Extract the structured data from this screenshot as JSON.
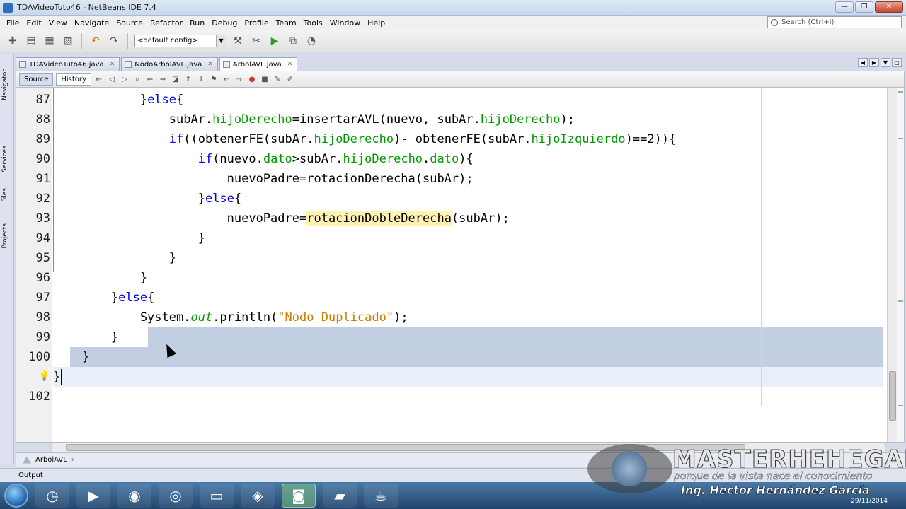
{
  "window": {
    "title": "TDAVideoTuto46 - NetBeans IDE 7.4",
    "buttons": [
      "—",
      "❐",
      "✕"
    ]
  },
  "menubar": {
    "items": [
      "File",
      "Edit",
      "View",
      "Navigate",
      "Source",
      "Refactor",
      "Run",
      "Debug",
      "Profile",
      "Team",
      "Tools",
      "Window",
      "Help"
    ],
    "search_placeholder": "Search (Ctrl+I)"
  },
  "toolbar": {
    "config_value": "<default config>",
    "icons": [
      "new-project-icon",
      "new-file-icon",
      "open-project-icon",
      "close-project-icon",
      "undo-icon",
      "redo-icon",
      "build-icon",
      "run-icon",
      "debug-icon",
      "profile-icon"
    ]
  },
  "side_panels": [
    "Navigator",
    "Services",
    "Files",
    "Projects"
  ],
  "editor_tabs": [
    {
      "label": "TDAVideoTuto46.java",
      "active": false
    },
    {
      "label": "NodoArbolAVL.java",
      "active": false
    },
    {
      "label": "ArbolAVL.java",
      "active": true
    }
  ],
  "editor_toolbar": {
    "source_label": "Source",
    "history_label": "History"
  },
  "code": {
    "lines": [
      {
        "num": "87",
        "text": "            }else{"
      },
      {
        "num": "88",
        "text": "                subAr.hijoDerecho=insertarAVL(nuevo, subAr.hijoDerecho);"
      },
      {
        "num": "89",
        "text": "                if((obtenerFE(subAr.hijoDerecho)- obtenerFE(subAr.hijoIzquierdo)==2)){"
      },
      {
        "num": "90",
        "text": "                    if(nuevo.dato>subAr.hijoDerecho.dato){"
      },
      {
        "num": "91",
        "text": "                        nuevoPadre=rotacionDerecha(subAr);"
      },
      {
        "num": "92",
        "text": "                    }else{"
      },
      {
        "num": "93",
        "text": "                        nuevoPadre=rotacionDobleDerecha(subAr);"
      },
      {
        "num": "94",
        "text": "                    }"
      },
      {
        "num": "95",
        "text": "                }"
      },
      {
        "num": "96",
        "text": "            }"
      },
      {
        "num": "97",
        "text": "        }else{"
      },
      {
        "num": "98",
        "text": "            System.out.println(\"Nodo Duplicado\");"
      },
      {
        "num": "99",
        "text": "        }"
      },
      {
        "num": "100",
        "text": "    }"
      },
      {
        "num": "",
        "text": "}"
      },
      {
        "num": "102",
        "text": ""
      }
    ]
  },
  "breadcrumb": {
    "label": "ArbolAVL"
  },
  "output": {
    "label": "Output"
  },
  "taskbar": {
    "date": "29/11/2014"
  },
  "watermark": {
    "title": "MASTERHEHEGAR",
    "subtitle": "porque de la vista nace el conocimiento",
    "author": "Ing. Héctor Hernández García"
  }
}
